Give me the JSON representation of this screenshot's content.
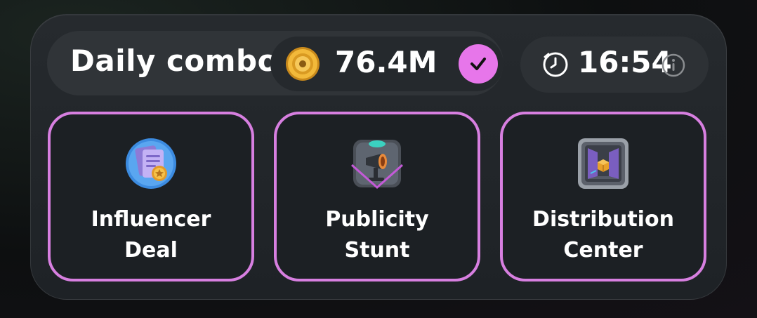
{
  "header": {
    "title": "Daily combo",
    "reward_amount": "76.4M",
    "reward_icon": "coin-icon",
    "completed_icon": "checkmark-icon",
    "timer": "16:54",
    "timer_icon": "clock-icon",
    "info_icon": "info-icon"
  },
  "cards": [
    {
      "label": "Influencer\nDeal",
      "icon": "document-star-icon"
    },
    {
      "label": "Publicity\nStunt",
      "icon": "megaphone-icon"
    },
    {
      "label": "Distribution\nCenter",
      "icon": "warehouse-box-icon"
    }
  ],
  "colors": {
    "accent": "#d77fe0",
    "check_bg": "#e776ea",
    "panel_bg": "#23272b"
  }
}
